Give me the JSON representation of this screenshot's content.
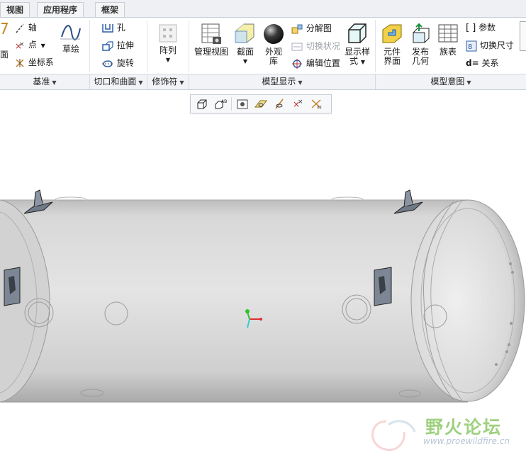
{
  "tabs": [
    {
      "label": "视图"
    },
    {
      "label": "应用程序"
    },
    {
      "label": "框架"
    }
  ],
  "ribbon": {
    "datum": {
      "plane_partial": "面",
      "axis": "轴",
      "point": "点",
      "csys": "坐标系",
      "sketch": "草绘",
      "group_label": "基准"
    },
    "cuts": {
      "hole": "孔",
      "extrude": "拉伸",
      "revolve": "旋转",
      "group_label": "切口和曲面"
    },
    "features": {
      "pattern": "阵列",
      "group_label": "修饰符"
    },
    "display": {
      "view_manager": "管理视图",
      "section": "截面",
      "appearance_line1": "外观",
      "appearance_line2": "库",
      "explode": "分解图",
      "toggle_status": "切换状况",
      "edit_position": "编辑位置",
      "display_style_line1": "显示样",
      "display_style_line2": "式",
      "group_label": "模型显示"
    },
    "intent": {
      "component_interface_line1": "元件",
      "component_interface_line2": "界面",
      "publish_geom_line1": "发布",
      "publish_geom_line2": "几何",
      "family_table": "族表",
      "parameters": "参数",
      "switch_dimensions": "切换尺寸",
      "relations": "关系",
      "group_label": "模型意图"
    }
  },
  "mini_toolbar": {
    "icons": [
      "saved-orientation-icon",
      "annotation-display-icon",
      "view-manager-icon",
      "spin-center-icon",
      "datum-display-icon",
      "axis-display-icon",
      "csys-display-icon"
    ]
  },
  "watermark": {
    "title": "野火论坛",
    "url": "www.proewildfire.cn"
  },
  "colors": {
    "ribbon_label_bar": "#f1f3f6",
    "model_gray": "#d6d6d6",
    "triad_x": "#e03030",
    "triad_y": "#30c030",
    "triad_z": "#30d0d0",
    "watermark_green": "#9fd07f"
  }
}
